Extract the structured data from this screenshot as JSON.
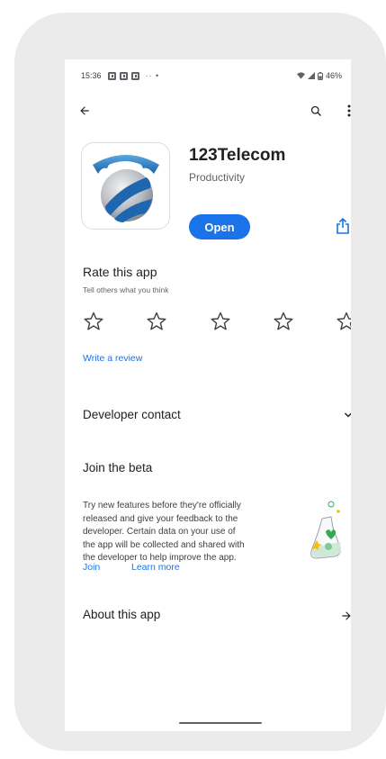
{
  "status_bar": {
    "time": "15:36",
    "notification_icons": [
      "b-app-icon",
      "b-app-icon",
      "b-app-icon"
    ],
    "more": "·· •",
    "battery": "46%"
  },
  "topbar": {
    "back_icon": "arrow-back-icon",
    "search_icon": "search-icon",
    "menu_icon": "more-vert-icon"
  },
  "app": {
    "name": "123Telecom",
    "category": "Productivity",
    "open_label": "Open",
    "share_icon": "share-icon"
  },
  "rating": {
    "title": "Rate this app",
    "subtitle": "Tell others what you think",
    "star_count": 5,
    "write_review": "Write a review"
  },
  "developer_contact": {
    "label": "Developer contact",
    "icon": "chevron-down-icon"
  },
  "beta": {
    "title": "Join the beta",
    "body_lines": [
      "Try new features before they're officially",
      "released and give your feedback to the",
      "developer. Certain data on your use of",
      "the app will be collected and shared with",
      "the developer to help improve the app."
    ],
    "join": "Join",
    "learn_more": "Learn more"
  },
  "about": {
    "label": "About this app",
    "icon": "arrow-forward-icon"
  },
  "colors": {
    "accent": "#1a73e8",
    "text": "#202124",
    "secondary": "#5f6368",
    "frame": "#ebebeb"
  }
}
